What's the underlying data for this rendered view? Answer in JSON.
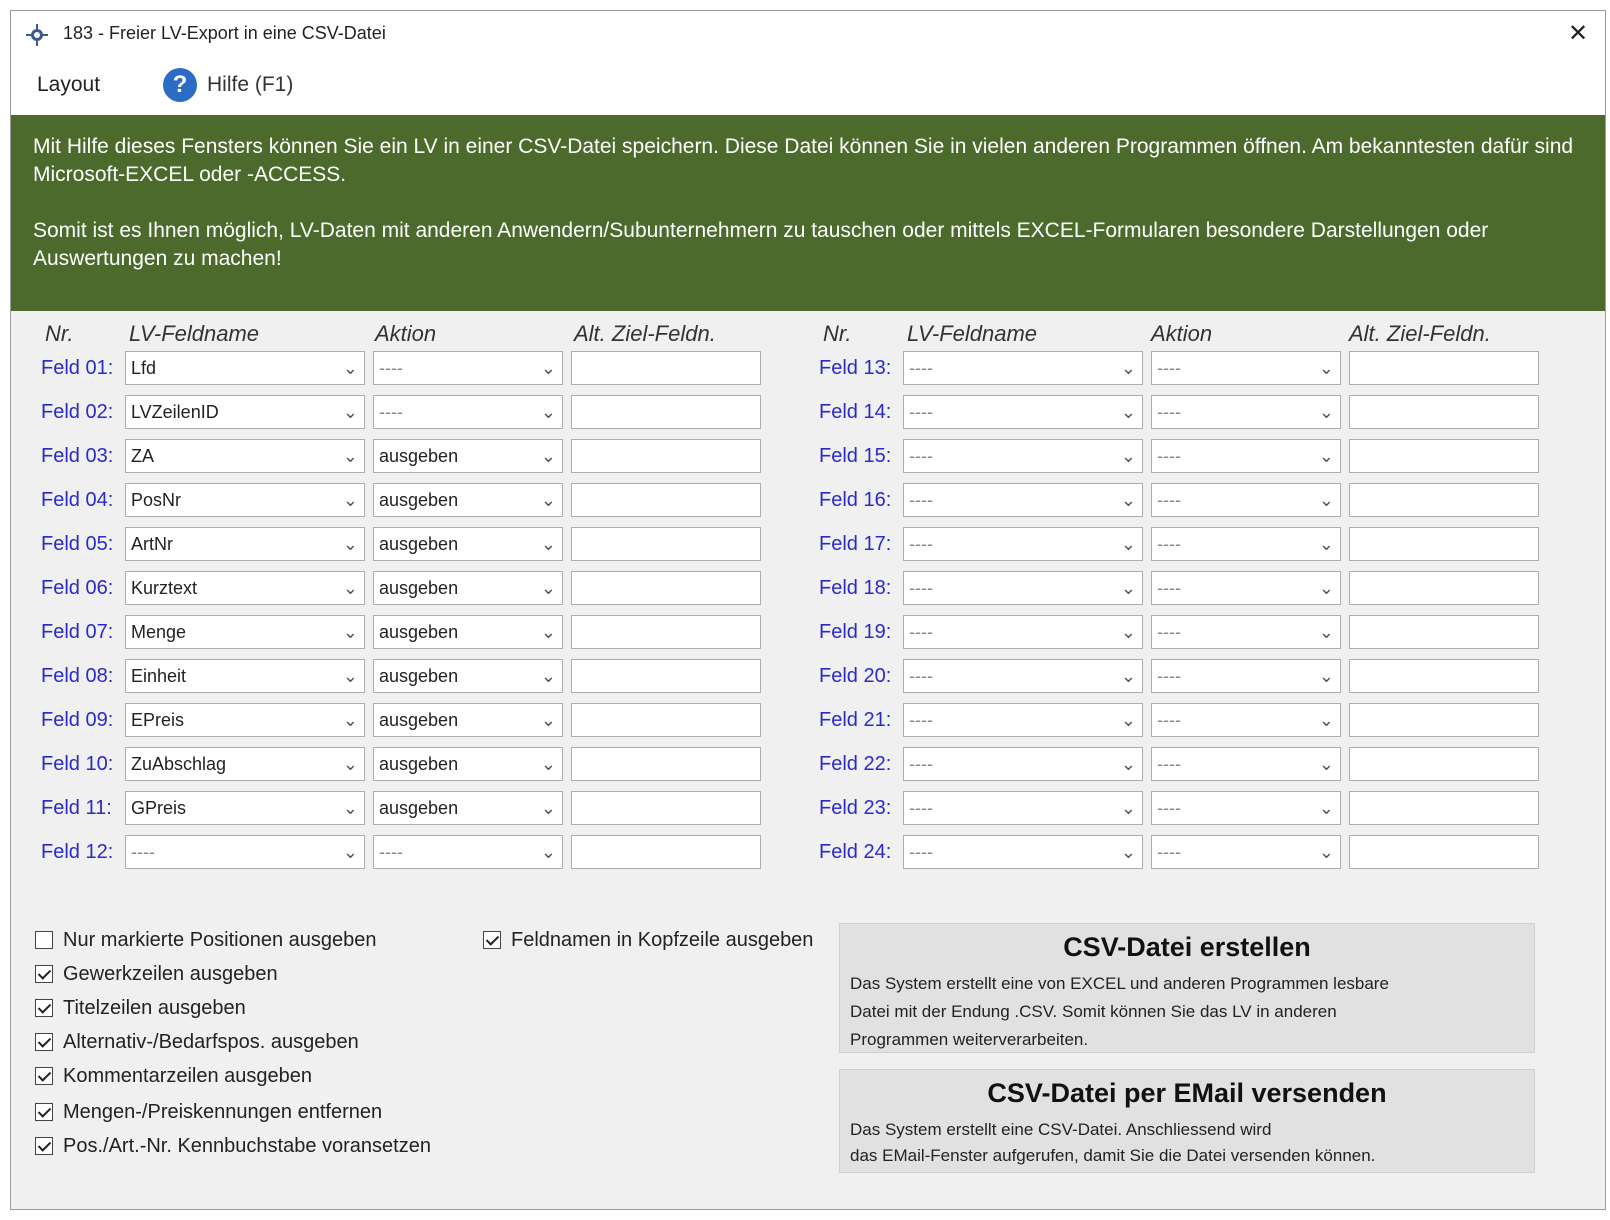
{
  "window": {
    "title": "183 - Freier LV-Export in eine CSV-Datei",
    "close_glyph": "✕"
  },
  "menu": {
    "layout_label": "Layout",
    "help_label": "Hilfe (F1)",
    "help_glyph": "?"
  },
  "info": {
    "para1": "Mit Hilfe dieses Fensters können Sie ein LV in einer CSV-Datei speichern. Diese Datei können Sie in vielen anderen Programmen öffnen. Am bekanntesten dafür sind Microsoft-EXCEL oder -ACCESS.",
    "para2": "Somit ist es Ihnen möglich, LV-Daten mit anderen Anwendern/Subunternehmern zu tauschen oder mittels EXCEL-Formularen besondere Darstellungen oder Auswertungen zu machen!",
    "background_color": "#4b6a2c"
  },
  "headers": {
    "nr": "Nr.",
    "feldname": "LV-Feldname",
    "aktion": "Aktion",
    "alt_ziel": "Alt. Ziel-Feldn."
  },
  "fields_left": [
    {
      "label": "Feld 01:",
      "feldname": "Lfd",
      "aktion": "----",
      "alt": ""
    },
    {
      "label": "Feld 02:",
      "feldname": "LVZeilenID",
      "aktion": "----",
      "alt": ""
    },
    {
      "label": "Feld 03:",
      "feldname": "ZA",
      "aktion": "ausgeben",
      "alt": ""
    },
    {
      "label": "Feld 04:",
      "feldname": "PosNr",
      "aktion": "ausgeben",
      "alt": ""
    },
    {
      "label": "Feld 05:",
      "feldname": "ArtNr",
      "aktion": "ausgeben",
      "alt": ""
    },
    {
      "label": "Feld 06:",
      "feldname": "Kurztext",
      "aktion": "ausgeben",
      "alt": ""
    },
    {
      "label": "Feld 07:",
      "feldname": "Menge",
      "aktion": "ausgeben",
      "alt": ""
    },
    {
      "label": "Feld 08:",
      "feldname": "Einheit",
      "aktion": "ausgeben",
      "alt": ""
    },
    {
      "label": "Feld 09:",
      "feldname": "EPreis",
      "aktion": "ausgeben",
      "alt": ""
    },
    {
      "label": "Feld 10:",
      "feldname": "ZuAbschlag",
      "aktion": "ausgeben",
      "alt": ""
    },
    {
      "label": "Feld 11:",
      "feldname": "GPreis",
      "aktion": "ausgeben",
      "alt": ""
    },
    {
      "label": "Feld 12:",
      "feldname": "----",
      "aktion": "----",
      "alt": ""
    }
  ],
  "fields_right": [
    {
      "label": "Feld 13:",
      "feldname": "----",
      "aktion": "----",
      "alt": ""
    },
    {
      "label": "Feld 14:",
      "feldname": "----",
      "aktion": "----",
      "alt": ""
    },
    {
      "label": "Feld 15:",
      "feldname": "----",
      "aktion": "----",
      "alt": ""
    },
    {
      "label": "Feld 16:",
      "feldname": "----",
      "aktion": "----",
      "alt": ""
    },
    {
      "label": "Feld 17:",
      "feldname": "----",
      "aktion": "----",
      "alt": ""
    },
    {
      "label": "Feld 18:",
      "feldname": "----",
      "aktion": "----",
      "alt": ""
    },
    {
      "label": "Feld 19:",
      "feldname": "----",
      "aktion": "----",
      "alt": ""
    },
    {
      "label": "Feld 20:",
      "feldname": "----",
      "aktion": "----",
      "alt": ""
    },
    {
      "label": "Feld 21:",
      "feldname": "----",
      "aktion": "----",
      "alt": ""
    },
    {
      "label": "Feld 22:",
      "feldname": "----",
      "aktion": "----",
      "alt": ""
    },
    {
      "label": "Feld 23:",
      "feldname": "----",
      "aktion": "----",
      "alt": ""
    },
    {
      "label": "Feld 24:",
      "feldname": "----",
      "aktion": "----",
      "alt": ""
    }
  ],
  "options": [
    {
      "label": "Nur markierte Positionen ausgeben",
      "checked": false
    },
    {
      "label": "Gewerkzeilen ausgeben",
      "checked": true
    },
    {
      "label": "Titelzeilen ausgeben",
      "checked": true
    },
    {
      "label": "Alternativ-/Bedarfspos. ausgeben",
      "checked": true
    },
    {
      "label": "Kommentarzeilen ausgeben",
      "checked": true
    },
    {
      "label": "Mengen-/Preiskennungen entfernen",
      "checked": true
    },
    {
      "label": "Pos./Art.-Nr. Kennbuchstabe voransetzen",
      "checked": true
    }
  ],
  "option_header_row": {
    "label": "Feldnamen in Kopfzeile ausgeben",
    "checked": true
  },
  "actions": {
    "create": {
      "title": "CSV-Datei erstellen",
      "desc1": "Das System erstellt eine von EXCEL und anderen Programmen lesbare",
      "desc2": "Datei mit der Endung .CSV. Somit können Sie das LV in anderen",
      "desc3": "Programmen weiterverarbeiten."
    },
    "email": {
      "title": "CSV-Datei per EMail versenden",
      "desc1": "Das System erstellt eine CSV-Datei. Anschliessend wird",
      "desc2": "das EMail-Fenster aufgerufen, damit Sie die Datei versenden können."
    }
  },
  "colors": {
    "field_label": "#2a2ac8",
    "help_icon": "#2b6cc4"
  }
}
